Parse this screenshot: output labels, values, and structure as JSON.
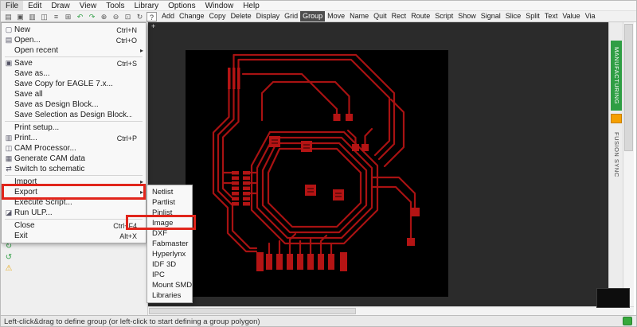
{
  "colors": {
    "accent-red": "#e1251b",
    "trace": "#a81212",
    "pad": "#b41414",
    "canvas-bg": "#2b2b2b",
    "board-bg": "#000000",
    "manufacturing-green": "#2f9e44",
    "fusion-orange": "#f59f00",
    "status-green": "#37a93c",
    "active-button-bg": "#4d4d4d"
  },
  "menubar": {
    "items": [
      {
        "label": "File",
        "cls": "active"
      },
      {
        "label": "Edit"
      },
      {
        "label": "Draw"
      },
      {
        "label": "View"
      },
      {
        "label": "Tools"
      },
      {
        "label": "Library"
      },
      {
        "label": "Options"
      },
      {
        "label": "Window"
      },
      {
        "label": "Help"
      }
    ]
  },
  "toolbar": {
    "icons": [
      {
        "glyph": "▤",
        "name": "open-icon"
      },
      {
        "glyph": "▣",
        "name": "save-icon"
      },
      {
        "glyph": "▥",
        "name": "print-icon"
      },
      {
        "glyph": "◫",
        "name": "cam-processor-icon"
      },
      {
        "glyph": "≡",
        "name": "layers-icon"
      },
      {
        "glyph": "⊞",
        "name": "grid-settings-icon"
      },
      {
        "glyph": "↶",
        "name": "undo-icon",
        "color": "#2f9e44"
      },
      {
        "glyph": "↷",
        "name": "redo-icon",
        "color": "#2f9e44"
      },
      {
        "glyph": "⊕",
        "name": "zoom-in-icon"
      },
      {
        "glyph": "⊖",
        "name": "zoom-out-icon"
      },
      {
        "glyph": "⊡",
        "name": "zoom-fit-icon"
      },
      {
        "glyph": "↻",
        "name": "redraw-icon"
      },
      {
        "glyph": "?",
        "name": "help-icon",
        "cls": "boxed"
      }
    ],
    "buttons": [
      {
        "label": "Add"
      },
      {
        "label": "Change"
      },
      {
        "label": "Copy"
      },
      {
        "label": "Delete"
      },
      {
        "label": "Display"
      },
      {
        "label": "Grid"
      },
      {
        "label": "Group",
        "cls": "active"
      },
      {
        "label": "Move"
      },
      {
        "label": "Name"
      },
      {
        "label": "Quit"
      },
      {
        "label": "Rect"
      },
      {
        "label": "Route"
      },
      {
        "label": "Script"
      },
      {
        "label": "Show"
      },
      {
        "label": "Signal"
      },
      {
        "label": "Slice"
      },
      {
        "label": "Split"
      },
      {
        "label": "Text"
      },
      {
        "label": "Value"
      },
      {
        "label": "Via"
      }
    ]
  },
  "file_menu": {
    "sections": {
      "s1": [
        {
          "icon": "▢",
          "label": "New",
          "shortcut": "Ctrl+N",
          "arrow": ""
        },
        {
          "icon": "▤",
          "label": "Open...",
          "shortcut": "Ctrl+O",
          "arrow": ""
        },
        {
          "icon": "",
          "label": "Open recent",
          "shortcut": "",
          "arrow": "▸"
        }
      ],
      "s2": [
        {
          "icon": "▣",
          "label": "Save",
          "shortcut": "Ctrl+S",
          "arrow": ""
        },
        {
          "icon": "",
          "label": "Save as...",
          "shortcut": "",
          "arrow": ""
        },
        {
          "icon": "",
          "label": "Save Copy for EAGLE 7.x...",
          "shortcut": "",
          "arrow": ""
        },
        {
          "icon": "",
          "label": "Save all",
          "shortcut": "",
          "arrow": ""
        },
        {
          "icon": "",
          "label": "Save as Design Block...",
          "shortcut": "",
          "arrow": ""
        },
        {
          "icon": "",
          "label": "Save Selection as Design Block...",
          "shortcut": "",
          "arrow": ""
        }
      ],
      "s3": [
        {
          "icon": "",
          "label": "Print setup...",
          "shortcut": "",
          "arrow": ""
        },
        {
          "icon": "▥",
          "label": "Print...",
          "shortcut": "Ctrl+P",
          "arrow": ""
        },
        {
          "icon": "◫",
          "label": "CAM Processor...",
          "shortcut": "",
          "arrow": ""
        },
        {
          "icon": "▦",
          "label": "Generate CAM data",
          "shortcut": "",
          "arrow": ""
        },
        {
          "icon": "⇄",
          "label": "Switch to schematic",
          "shortcut": "",
          "arrow": ""
        }
      ],
      "s4": [
        {
          "icon": "",
          "label": "Import",
          "shortcut": "",
          "arrow": "▸"
        },
        {
          "icon": "",
          "label": "Export",
          "shortcut": "",
          "arrow": "▸"
        },
        {
          "icon": "",
          "label": "Execute Script...",
          "shortcut": "",
          "arrow": ""
        },
        {
          "icon": "◪",
          "label": "Run ULP...",
          "shortcut": "",
          "arrow": ""
        }
      ],
      "s5": [
        {
          "icon": "",
          "label": "Close",
          "shortcut": "Ctrl+F4",
          "arrow": ""
        },
        {
          "icon": "",
          "label": "Exit",
          "shortcut": "Alt+X",
          "arrow": ""
        }
      ]
    }
  },
  "export_submenu": {
    "items": [
      "Netlist",
      "Partlist",
      "Pinlist",
      "Image",
      "DXF",
      "Fabmaster",
      "Hyperlynx",
      "IDF 3D",
      "IPC",
      "Mount SMD",
      "Libraries"
    ],
    "highlighted": "Image"
  },
  "side_tabs": {
    "manufacturing": "MANUFACTURING",
    "fusion_sync": "FUSION SYNC"
  },
  "left_tools": [
    {
      "glyph": "↻",
      "name": "refresh-icon",
      "color": "#2f9e44"
    },
    {
      "glyph": "↺",
      "name": "sync-icon",
      "color": "#2f9e44"
    },
    {
      "glyph": "⚠",
      "name": "warning-icon",
      "color": "#e6a817"
    }
  ],
  "statusbar": {
    "text": "Left-click&drag to define group (or left-click to start defining a group polygon)"
  }
}
